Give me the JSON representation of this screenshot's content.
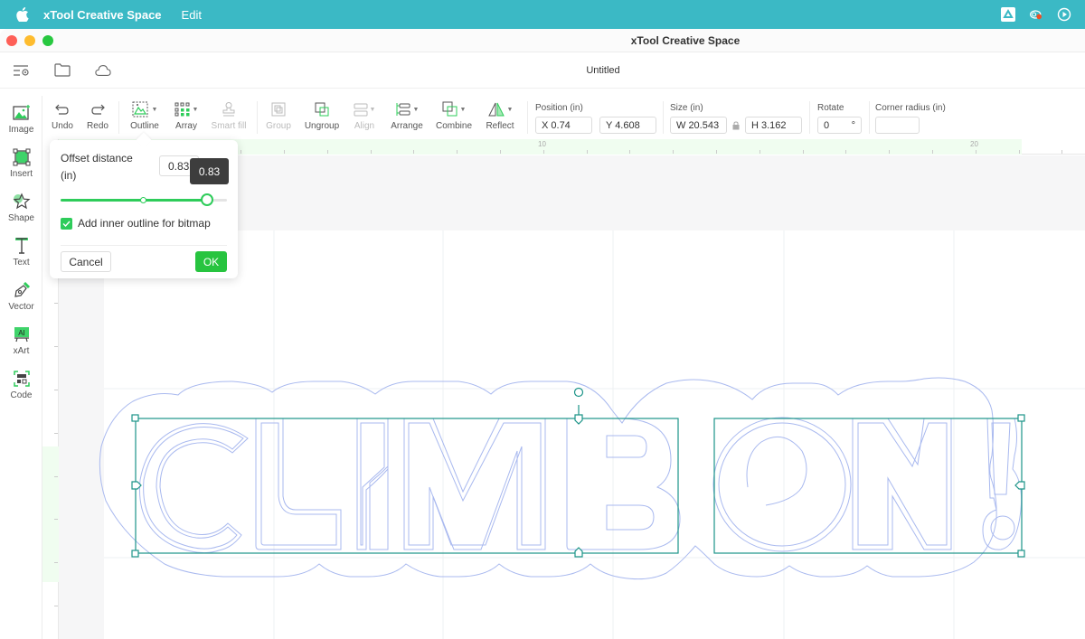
{
  "menubar": {
    "app_name": "xTool Creative Space",
    "menus": [
      "Edit"
    ],
    "tray_icons": [
      "drive-icon",
      "creative-cloud-icon",
      "play-circle-icon"
    ]
  },
  "window": {
    "title": "xTool Creative Space"
  },
  "topbar": {
    "document_title": "Untitled"
  },
  "left_tools": [
    {
      "label": "Image",
      "icon": "image-icon"
    },
    {
      "label": "Insert",
      "icon": "insert-icon"
    },
    {
      "label": "Shape",
      "icon": "star-icon"
    },
    {
      "label": "Text",
      "icon": "text-icon"
    },
    {
      "label": "Vector",
      "icon": "pen-icon"
    },
    {
      "label": "xArt",
      "icon": "ai-art-icon"
    },
    {
      "label": "Code",
      "icon": "qr-code-icon"
    }
  ],
  "toolbar": {
    "undo": "Undo",
    "redo": "Redo",
    "outline": "Outline",
    "array": "Array",
    "smart_fill": "Smart fill",
    "group": "Group",
    "ungroup": "Ungroup",
    "align": "Align",
    "arrange": "Arrange",
    "combine": "Combine",
    "reflect": "Reflect",
    "position_label": "Position (in)",
    "x_value": "X 0.74",
    "y_value": "Y 4.608",
    "size_label": "Size (in)",
    "w_value": "W 20.543",
    "h_value": "H 3.162",
    "rotate_label": "Rotate",
    "rotate_value": "0",
    "rotate_unit": "°",
    "corner_radius_label": "Corner radius (in)",
    "corner_radius_value": ""
  },
  "rulers": {
    "h_labels": [
      "0",
      "10",
      "20"
    ]
  },
  "offset_popover": {
    "label": "Offset distance (in)",
    "value": "0.83",
    "tooltip": "0.83",
    "slider_fraction": 0.88,
    "checkbox_label": "Add inner outline for bitmap",
    "checkbox_checked": true,
    "cancel": "Cancel",
    "ok": "OK"
  },
  "design": {
    "text": "CLIMB ON!",
    "outline_color": "#a9b9ef",
    "selection_color": "#1c9488"
  }
}
